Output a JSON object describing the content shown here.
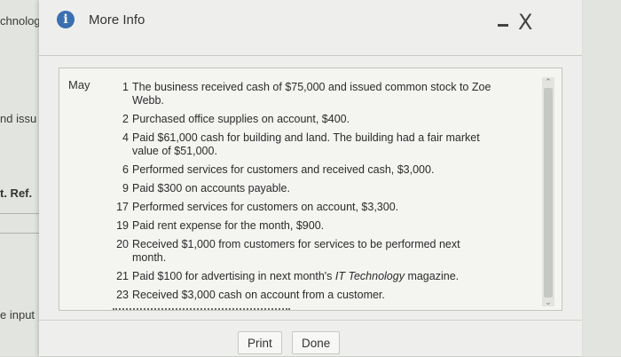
{
  "background": {
    "frag1": "chnolog",
    "frag2": "nd issu",
    "frag3": "t. Ref.",
    "frag4": "e input"
  },
  "dialog": {
    "title": "More Info",
    "info_icon": "info-icon",
    "minimize_icon": "minimize-icon",
    "close_icon": "close-icon",
    "close_glyph": "X",
    "month": "May",
    "entries": [
      {
        "num": "1",
        "text": "The business received cash of $75,000 and issued common stock to Zoe Webb."
      },
      {
        "num": "2",
        "text": "Purchased office supplies on account, $400."
      },
      {
        "num": "4",
        "text": "Paid $61,000 cash for building and land. The building had a fair market value of $51,000."
      },
      {
        "num": "6",
        "text": "Performed services for customers and received cash, $3,000."
      },
      {
        "num": "9",
        "text": "Paid $300 on accounts payable."
      },
      {
        "num": "17",
        "text": "Performed services for customers on account, $3,300."
      },
      {
        "num": "19",
        "text": "Paid rent expense for the month, $900."
      },
      {
        "num": "20",
        "text": "Received $1,000 from customers for services to be performed next month."
      },
      {
        "num": "21",
        "text": "Paid $100 for advertising in next month's IT Technology magazine."
      },
      {
        "num": "23",
        "text": "Received $3,000 cash on account from a customer."
      }
    ],
    "print_label": "Print",
    "done_label": "Done"
  }
}
